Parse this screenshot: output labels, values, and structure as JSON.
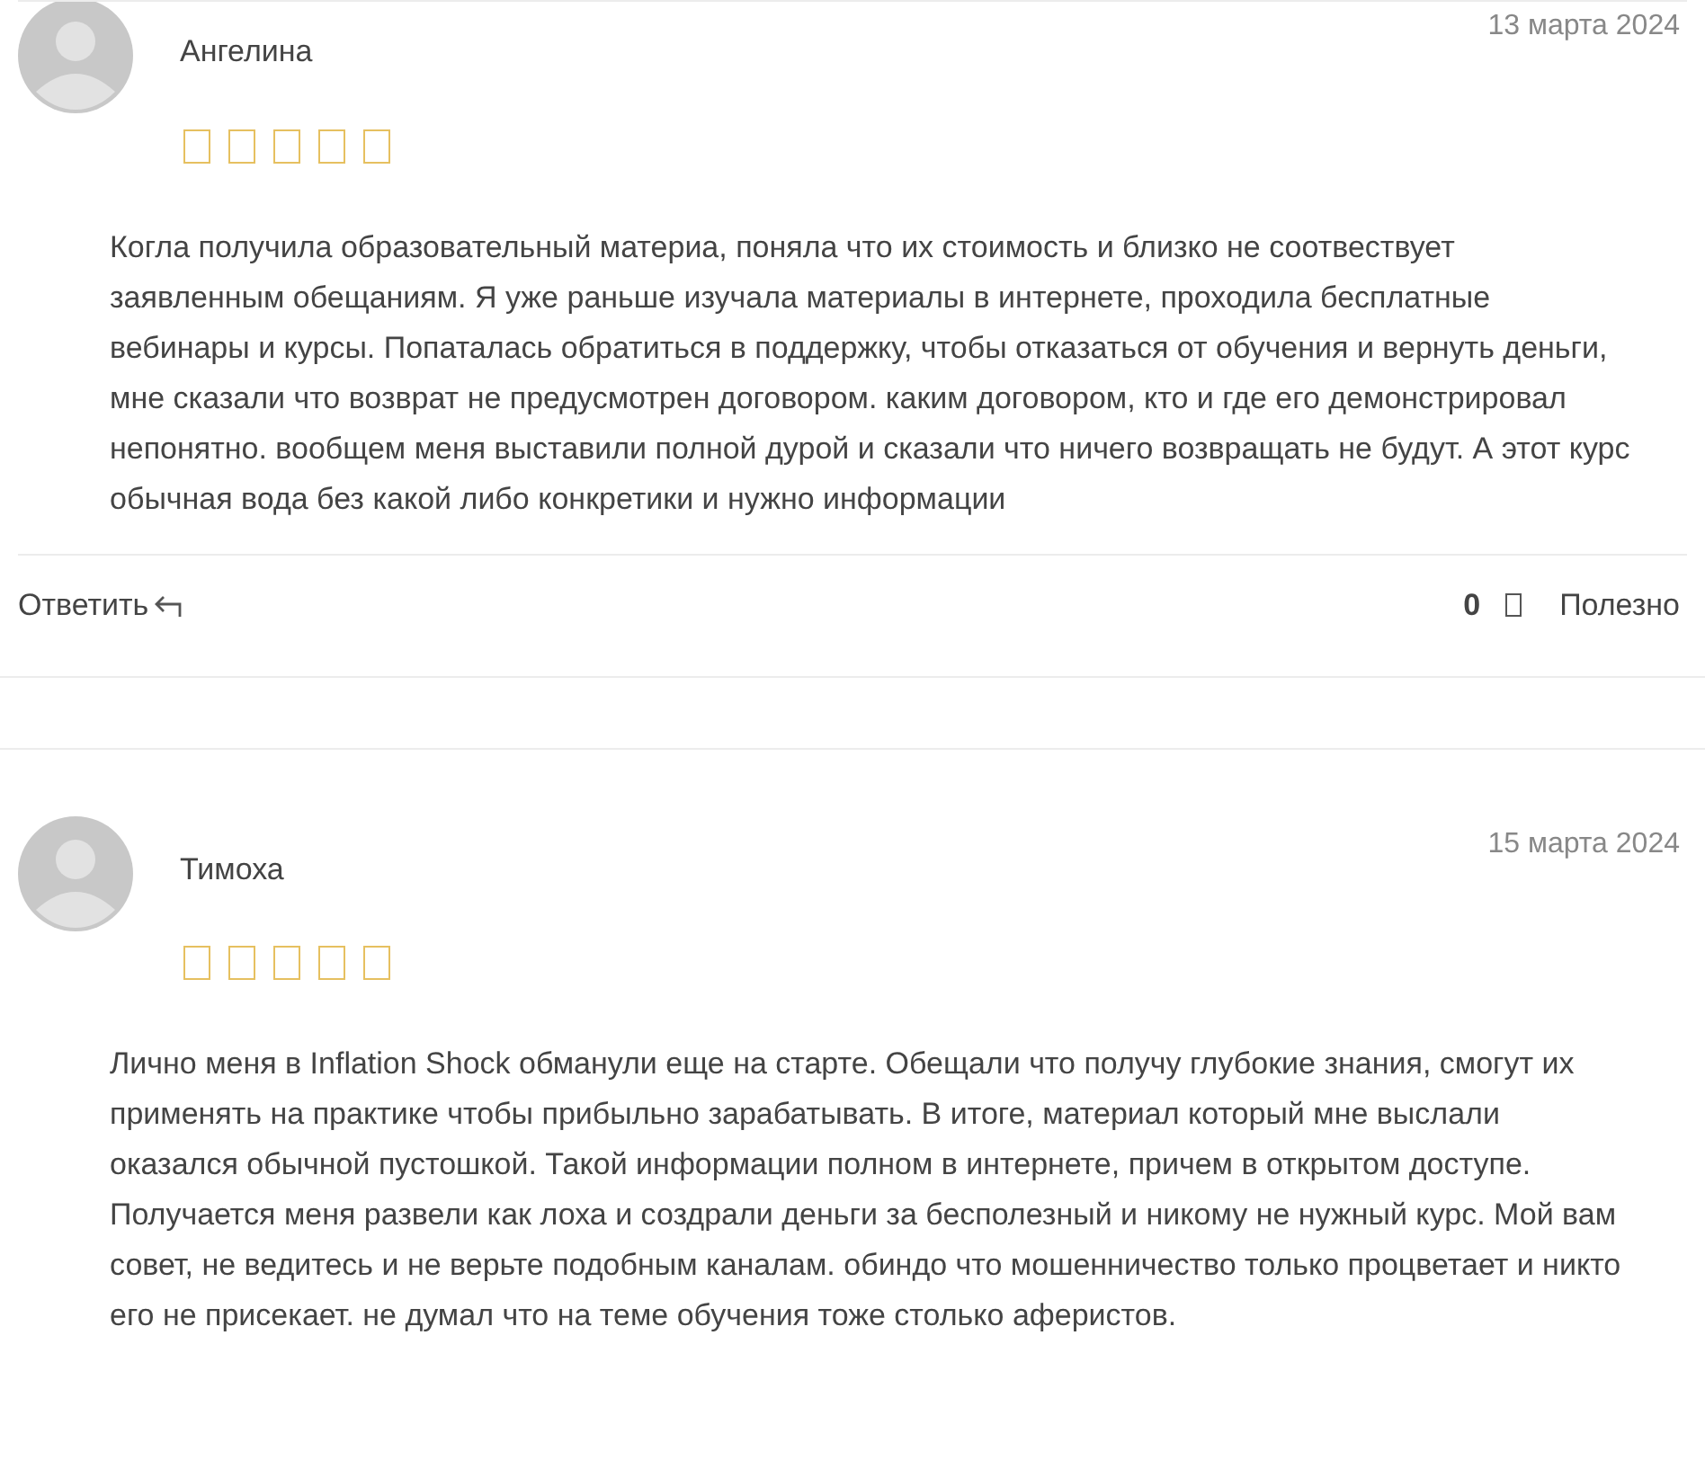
{
  "reviews": [
    {
      "author": "Ангелина",
      "date": "13 марта 2024",
      "text": "Когла получила образовательный материа, поняла что их стоимость и близко не соотвествует заявленным обещаниям. Я уже раньше изучала материалы в интернете, проходила бесплатные вебинары и курсы. Попаталась обратиться в поддержку, чтобы отказаться от обучения и вернуть деньги, мне сказали что возврат не предусмотрен договором. каким договором, кто и где его демонстрировал непонятно. вообщем меня выставили полной дурой и сказали что ничего возвращать не будут. А этот курс обычная вода без какой либо конкретики и нужно информации",
      "reply": "Ответить",
      "votes": "0",
      "helpful": "Полезно"
    },
    {
      "author": "Тимоха",
      "date": "15 марта 2024",
      "text": "Лично меня в Inflation Shock обманули еще на старте. Обещали что получу глубокие знания, смогут их применять на практике чтобы прибыльно зарабатывать. В итоге, материал который мне выслали оказался обычной пустошкой. Такой информации полном в интернете, причем в открытом доступе. Получается меня развели как лоха и создрали деньги за бесполезный и никому не нужный курс. Мой вам совет, не ведитесь и не верьте подобным каналам. обиндо что мошенничество только процветает и никто его не присекает. не думал что на теме обучения тоже столько аферистов."
    }
  ]
}
